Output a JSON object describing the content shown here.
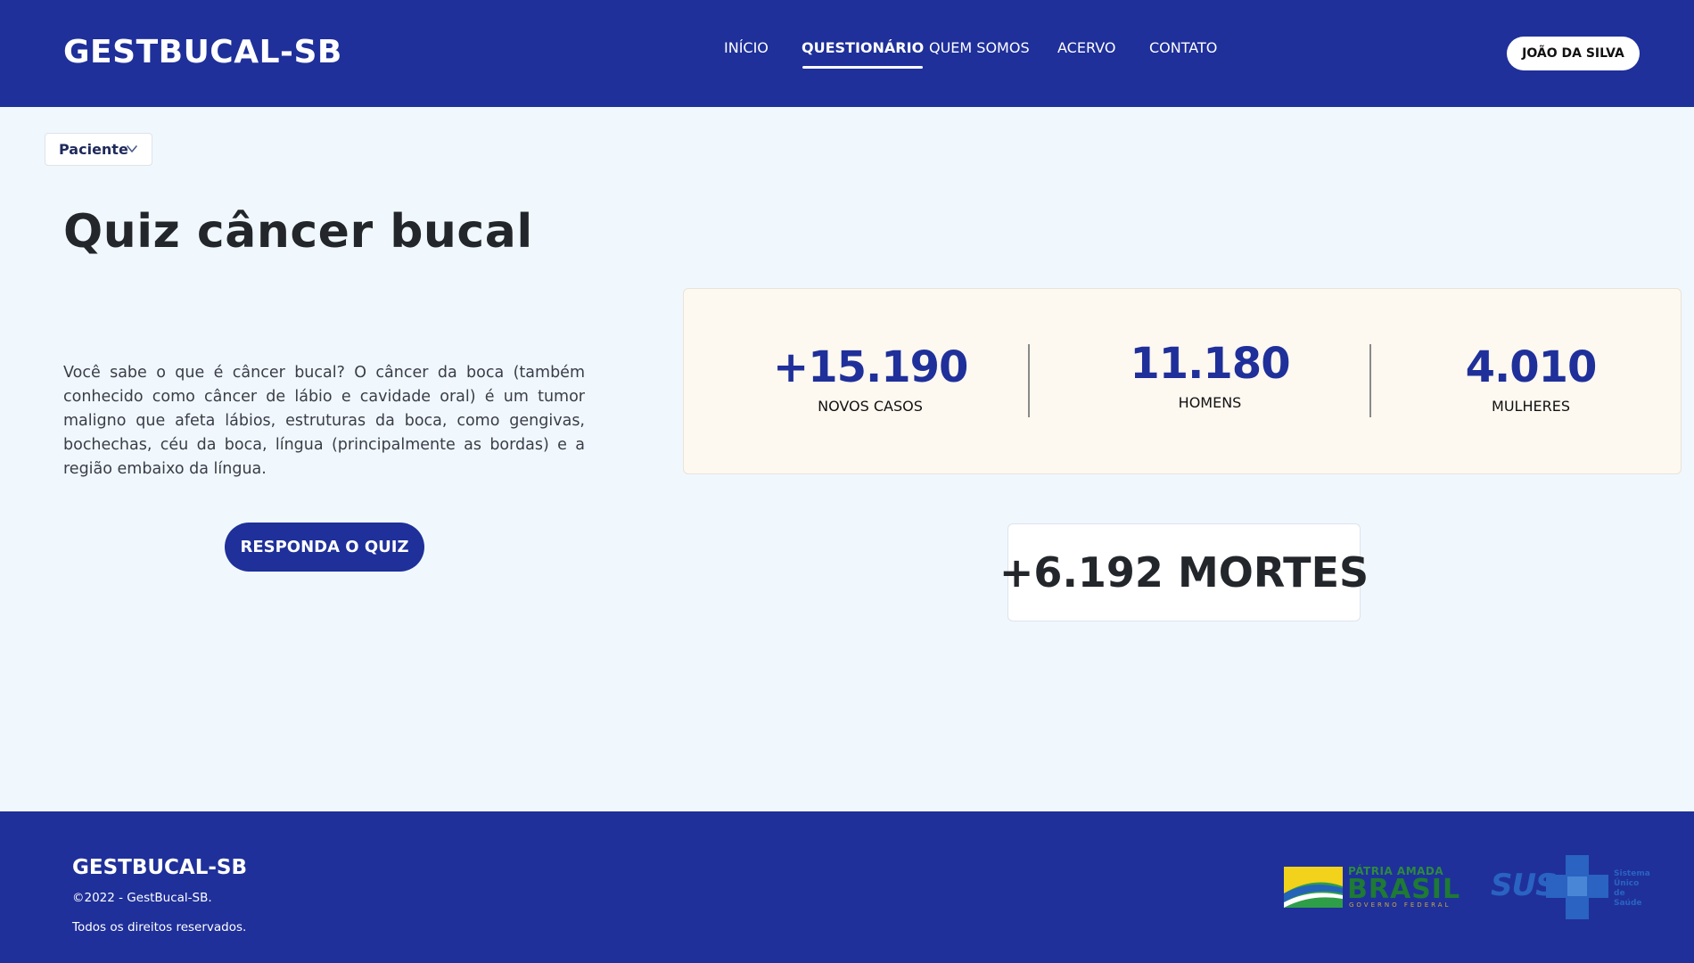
{
  "header": {
    "logo": "GESTBUCAL-SB",
    "nav": [
      {
        "label": "INÍCIO",
        "active": false
      },
      {
        "label": "QUESTIONÁRIO",
        "active": true
      },
      {
        "label": "QUEM SOMOS",
        "active": false
      },
      {
        "label": "ACERVO",
        "active": false
      },
      {
        "label": "CONTATO",
        "active": false
      }
    ],
    "user_button": "JOÃO DA SILVA"
  },
  "role_select": {
    "value": "Paciente"
  },
  "main": {
    "title": "Quiz câncer bucal",
    "description": "Você sabe o que é câncer bucal? O câncer da boca (também conhecido como câncer de lábio e cavidade oral) é um tumor maligno que afeta lábios, estruturas da boca, como  gengivas, bochechas, céu da boca, língua (principalmente as bordas) e a região embaixo da língua.",
    "quiz_button": "RESPONDA O QUIZ"
  },
  "stats": [
    {
      "value": "+15.190",
      "label": "NOVOS CASOS"
    },
    {
      "value": "11.180",
      "label": "HOMENS"
    },
    {
      "value": "4.010",
      "label": "MULHERES"
    }
  ],
  "deaths": "+6.192 MORTES",
  "footer": {
    "logo": "GESTBUCAL-SB",
    "copyright": "©2022 - GestBucal-SB.",
    "rights": "Todos os direitos reservados.",
    "gov_logo": {
      "line1": "PÁTRIA AMADA",
      "line2": "BRASIL",
      "line3": "GOVERNO FEDERAL"
    },
    "sus_logo": {
      "name": "SUS",
      "line1": "Sistema",
      "line2": "Único",
      "line3": "de Saúde"
    }
  },
  "colors": {
    "primary": "#1f309a",
    "background": "#f0f8fe",
    "card_bg": "#fdf8f0",
    "sus_blue": "#2a63c2",
    "gov_green": "#1e7a34"
  }
}
